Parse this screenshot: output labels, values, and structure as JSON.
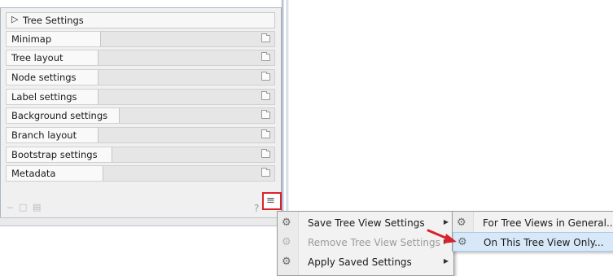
{
  "panel": {
    "title": "Tree Settings",
    "rows": [
      {
        "label": "Minimap"
      },
      {
        "label": "Tree layout"
      },
      {
        "label": "Node settings"
      },
      {
        "label": "Label settings"
      },
      {
        "label": "Background settings"
      },
      {
        "label": "Branch layout"
      },
      {
        "label": "Bootstrap settings"
      },
      {
        "label": "Metadata"
      }
    ],
    "help": "?"
  },
  "menu": {
    "items": [
      {
        "label": "Save Tree View Settings",
        "enabled": true,
        "has_submenu": true,
        "icon": "gear-icon"
      },
      {
        "label": "Remove Tree View Settings",
        "enabled": false,
        "has_submenu": true,
        "icon": "gear-icon"
      },
      {
        "label": "Apply Saved Settings",
        "enabled": true,
        "has_submenu": true,
        "icon": "gear-icon"
      }
    ]
  },
  "submenu": {
    "items": [
      {
        "label": "For Tree Views in General...",
        "icon": "gear-icon"
      },
      {
        "label": "On This Tree View Only...",
        "icon": "gear-icon"
      }
    ]
  },
  "colors": {
    "highlight": "#d9232a",
    "menu_hover": "#d7e9f9"
  }
}
